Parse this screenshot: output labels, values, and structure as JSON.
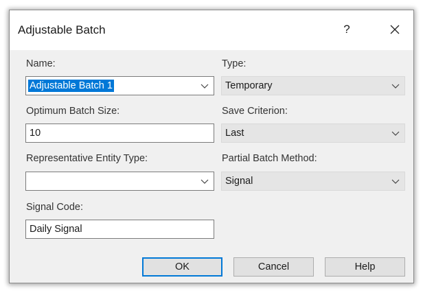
{
  "dialog": {
    "title": "Adjustable Batch",
    "help_glyph": "?",
    "close_icon": "close-icon"
  },
  "fields": {
    "name": {
      "label": "Name:",
      "value": "Adjustable Batch 1"
    },
    "type": {
      "label": "Type:",
      "value": "Temporary"
    },
    "optimum_batch_size": {
      "label": "Optimum Batch Size:",
      "value": "10"
    },
    "save_criterion": {
      "label": "Save Criterion:",
      "value": "Last"
    },
    "representative_entity_type": {
      "label": "Representative Entity Type:",
      "value": ""
    },
    "partial_batch_method": {
      "label": "Partial Batch Method:",
      "value": "Signal"
    },
    "signal_code": {
      "label": "Signal Code:",
      "value": "Daily Signal"
    }
  },
  "buttons": {
    "ok": "OK",
    "cancel": "Cancel",
    "help": "Help"
  },
  "colors": {
    "accent": "#0078d7",
    "panel_bg": "#f0f0f0",
    "disabled_field_bg": "#e5e5e5"
  }
}
